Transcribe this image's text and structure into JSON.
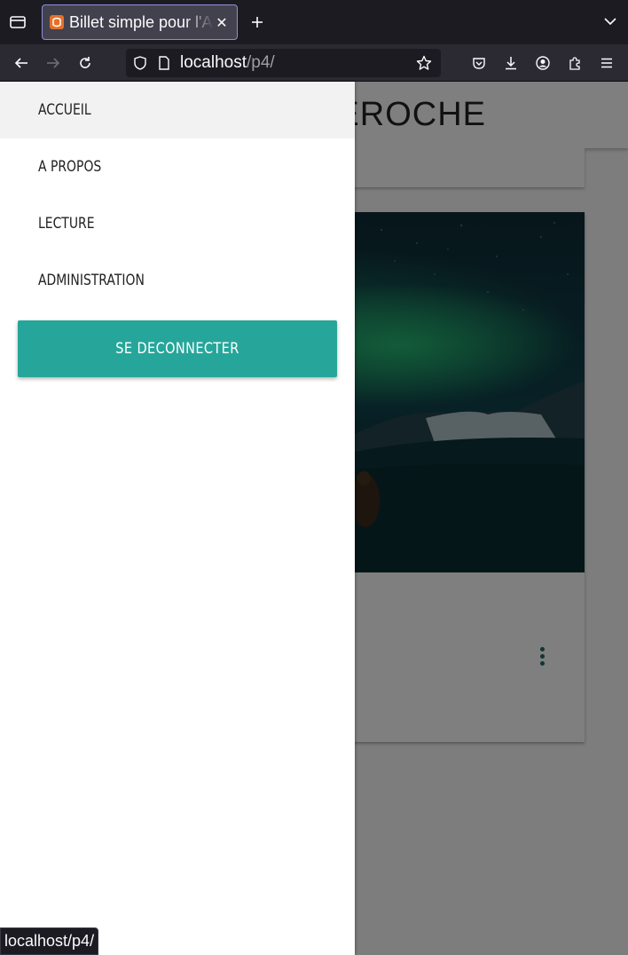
{
  "browser": {
    "tab": {
      "title": "Billet simple pour l'Alaska"
    },
    "url": {
      "host": "localhost",
      "path": "/p4/"
    },
    "status_url": "localhost/p4/"
  },
  "page": {
    "site_title": "JEAN FORTEROCHE"
  },
  "drawer": {
    "items": [
      {
        "label": "ACCUEIL",
        "active": true
      },
      {
        "label": "A PROPOS",
        "active": false
      },
      {
        "label": "LECTURE",
        "active": false
      },
      {
        "label": "ADMINISTRATION",
        "active": false
      }
    ],
    "logout_label": "SE DECONNECTER"
  },
  "colors": {
    "accent": "#26a69a",
    "chrome_dark": "#1c1b22",
    "chrome_toolbar": "#2b2a33"
  }
}
